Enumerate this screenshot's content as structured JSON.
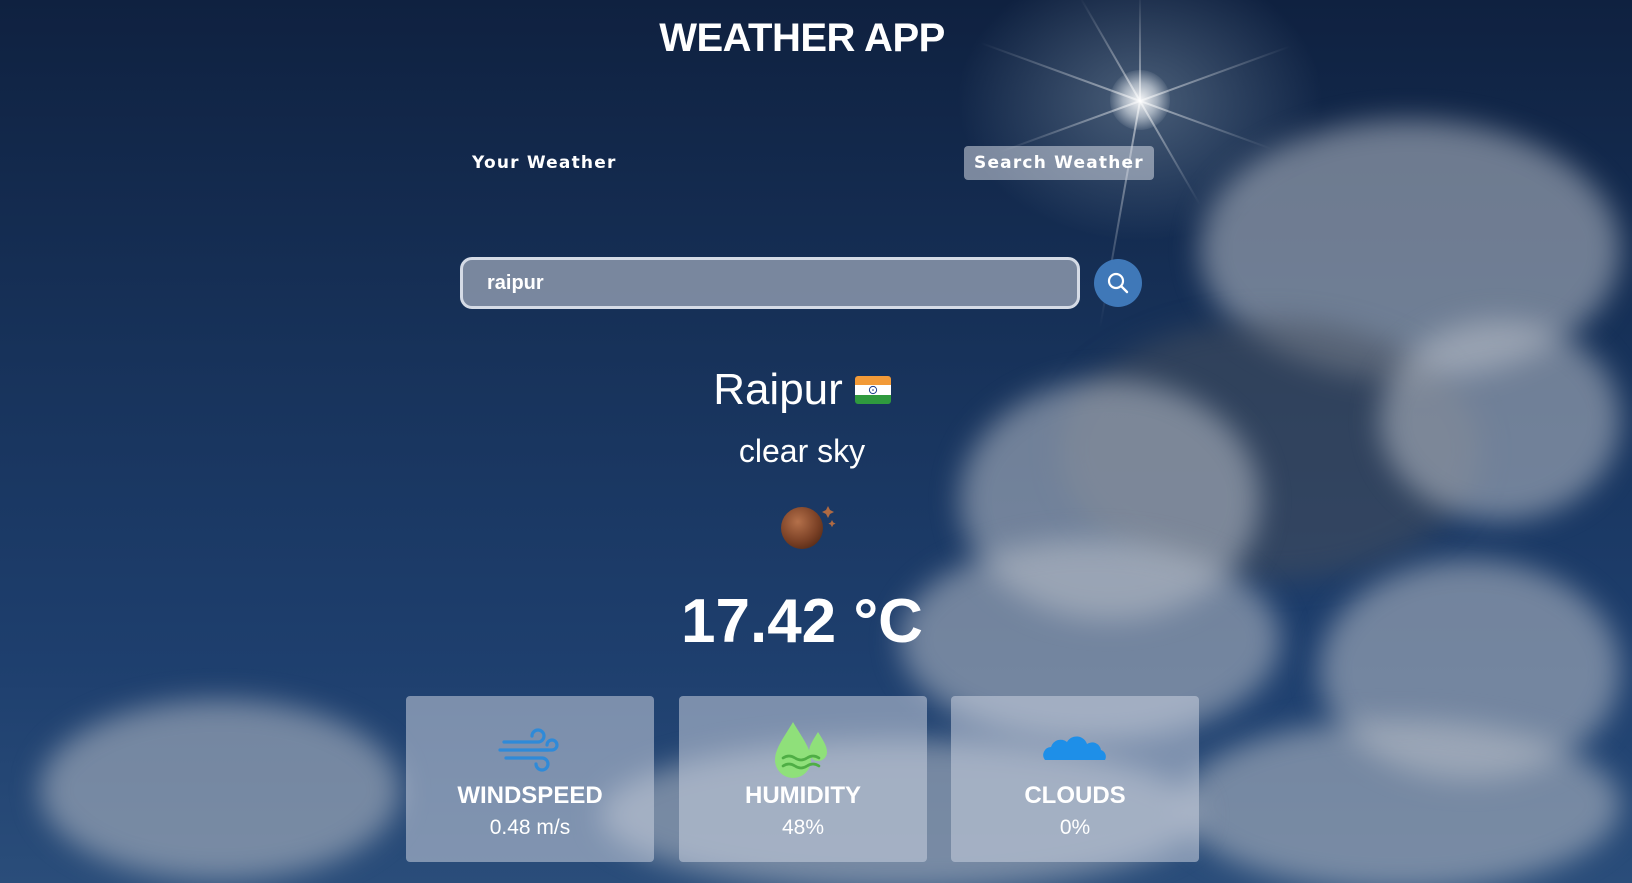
{
  "app": {
    "title": "WEATHER APP"
  },
  "tabs": [
    {
      "label": "Your Weather",
      "active": false
    },
    {
      "label": "Search Weather",
      "active": true
    }
  ],
  "search": {
    "value": "raipur",
    "icon": "search-icon"
  },
  "weather": {
    "city": "Raipur",
    "country_flag": "india-flag-icon",
    "description": "clear sky",
    "condition_icon": "moon-clear-night-icon",
    "temperature": "17.42 °C"
  },
  "stats": [
    {
      "label": "WINDSPEED",
      "value": "0.48 m/s",
      "icon": "wind-icon",
      "color": "#2f8ad8"
    },
    {
      "label": "HUMIDITY",
      "value": "48%",
      "icon": "humidity-drop-icon",
      "color": "#8fe07a"
    },
    {
      "label": "CLOUDS",
      "value": "0%",
      "icon": "cloud-icon",
      "color": "#1e8fe8"
    }
  ],
  "colors": {
    "search_button": "#3f78b8",
    "active_tab_bg": "#d2d7e1"
  }
}
